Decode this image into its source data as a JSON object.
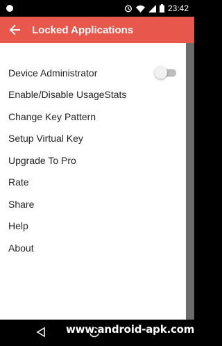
{
  "status_bar": {
    "time": "23:42",
    "icons": [
      "notification-dot-icon",
      "alarm-icon",
      "wifi-icon",
      "cellular-icon",
      "battery-icon"
    ]
  },
  "app_bar": {
    "title": "Locked Applications",
    "back_icon": "arrow-left-icon",
    "color": "#e8574b"
  },
  "menu": {
    "items": [
      {
        "label": "Device Administrator",
        "has_toggle": true,
        "toggle_on": false
      },
      {
        "label": "Enable/Disable UsageStats"
      },
      {
        "label": "Change Key Pattern"
      },
      {
        "label": "Setup Virtual Key"
      },
      {
        "label": "Upgrade To Pro"
      },
      {
        "label": "Rate"
      },
      {
        "label": "Share"
      },
      {
        "label": "Help"
      },
      {
        "label": "About"
      }
    ]
  },
  "nav_bar": {
    "icons": [
      "back-triangle-icon",
      "home-circle-icon"
    ]
  },
  "watermark": {
    "text": "www.android-apk.com"
  }
}
